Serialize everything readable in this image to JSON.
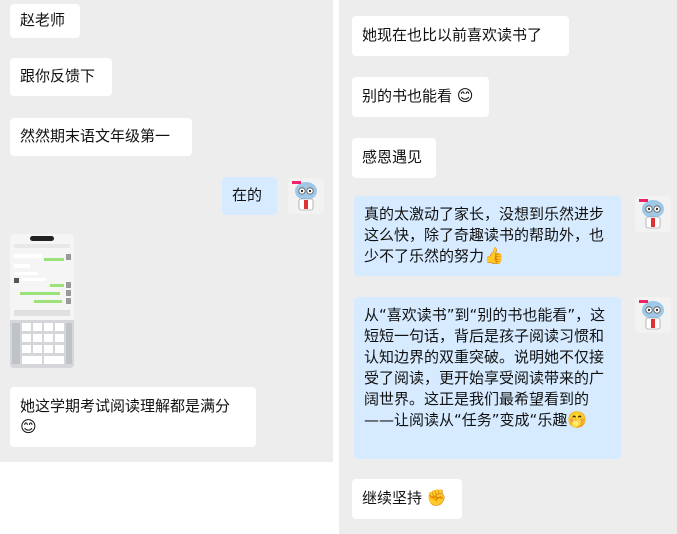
{
  "left": {
    "messages": [
      {
        "text": "赵老师"
      },
      {
        "text": "跟你反馈下"
      },
      {
        "text": "然然期末语文年级第一"
      },
      {
        "text": "在的"
      },
      {
        "text": "她这学期考试阅读理解都是满分"
      }
    ]
  },
  "right": {
    "messages": [
      {
        "text": "她现在也比以前喜欢读书了"
      },
      {
        "text": "别的书也能看"
      },
      {
        "text": "感恩遇见"
      },
      {
        "text": "真的太激动了家长，没想到乐然进步这么快，除了奇趣读书的帮助外，也少不了乐然的努力"
      },
      {
        "text": "从“喜欢读书”到“别的书也能看”，这短短一句话，背后是孩子阅读习惯和认知边界的双重突破。说明她不仅接受了阅读，更开始享受阅读带来的广阔世界。这正是我们最希望看到的——让阅读从“任务”变成“乐趣"
      },
      {
        "text": "继续坚持"
      }
    ]
  },
  "emojis": {
    "smile": "😊",
    "thumbs_up": "👍",
    "smirk": "🤭",
    "fist": "✊"
  },
  "colors": {
    "chat_bg": "#ededed",
    "received_bubble": "#ffffff",
    "sent_bubble": "#d6ebff"
  }
}
